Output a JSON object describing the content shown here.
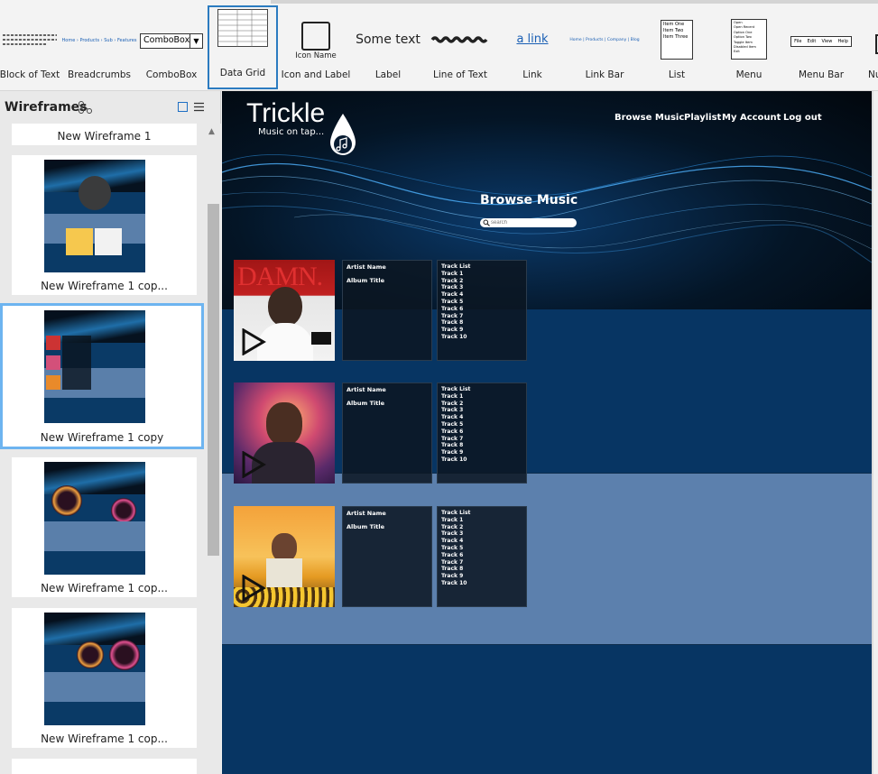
{
  "toolbar": {
    "components": [
      {
        "label": "Block of Text"
      },
      {
        "label": "Breadcrumbs",
        "preview": "Home › Products › Sub › Features"
      },
      {
        "label": "ComboBox",
        "preview": "ComboBox"
      },
      {
        "label": "Data Grid"
      },
      {
        "label": "Icon and Label",
        "preview": "Icon Name"
      },
      {
        "label": "Label",
        "preview": "Some text"
      },
      {
        "label": "Line of Text"
      },
      {
        "label": "Link",
        "preview": "a link"
      },
      {
        "label": "Link Bar",
        "preview": "Home | Products | Company | Blog"
      },
      {
        "label": "List",
        "items": [
          "Item One",
          "Item Two",
          "Item Three"
        ]
      },
      {
        "label": "Menu",
        "items": [
          "Open",
          "Open Recent",
          "Option One",
          "Option Two",
          "Toggle Item",
          "Disabled Item",
          "Exit"
        ]
      },
      {
        "label": "Menu Bar",
        "items": [
          "File",
          "Edit",
          "View",
          "Help"
        ]
      },
      {
        "label": "Nu"
      }
    ]
  },
  "panel": {
    "title": "Wireframes",
    "wireframes": [
      {
        "name": "New Wireframe 1"
      },
      {
        "name": "New Wireframe 1 cop..."
      },
      {
        "name": "New Wireframe 1 copy"
      },
      {
        "name": "New Wireframe 1 cop..."
      },
      {
        "name": "New Wireframe 1 cop..."
      }
    ]
  },
  "site": {
    "logo": "Trickle",
    "tagline": "Music on tap...",
    "nav": [
      "Browse Music",
      "Playlist",
      "My Account",
      "Log out"
    ],
    "heading": "Browse Music",
    "search_placeholder": "search",
    "albums": [
      {
        "cover_text": "DAMN.",
        "artist_label": "Artist Name",
        "album_label": "Album Title"
      },
      {
        "artist_label": "Artist Name",
        "album_label": "Album Title"
      },
      {
        "artist_label": "Artist Name",
        "album_label": "Album Title"
      }
    ],
    "track_list_title": "Track List",
    "tracks_a": [
      "Track 1",
      "Track 2",
      "Track 3",
      "Track 4",
      "Track 5",
      "Track 6",
      "Track 7",
      "Track 8",
      "Track 9",
      "Track 10"
    ]
  },
  "colors": {
    "canvas_bg": "#073563",
    "band_light": "#5c80ad",
    "selection": "#6db4f0"
  }
}
